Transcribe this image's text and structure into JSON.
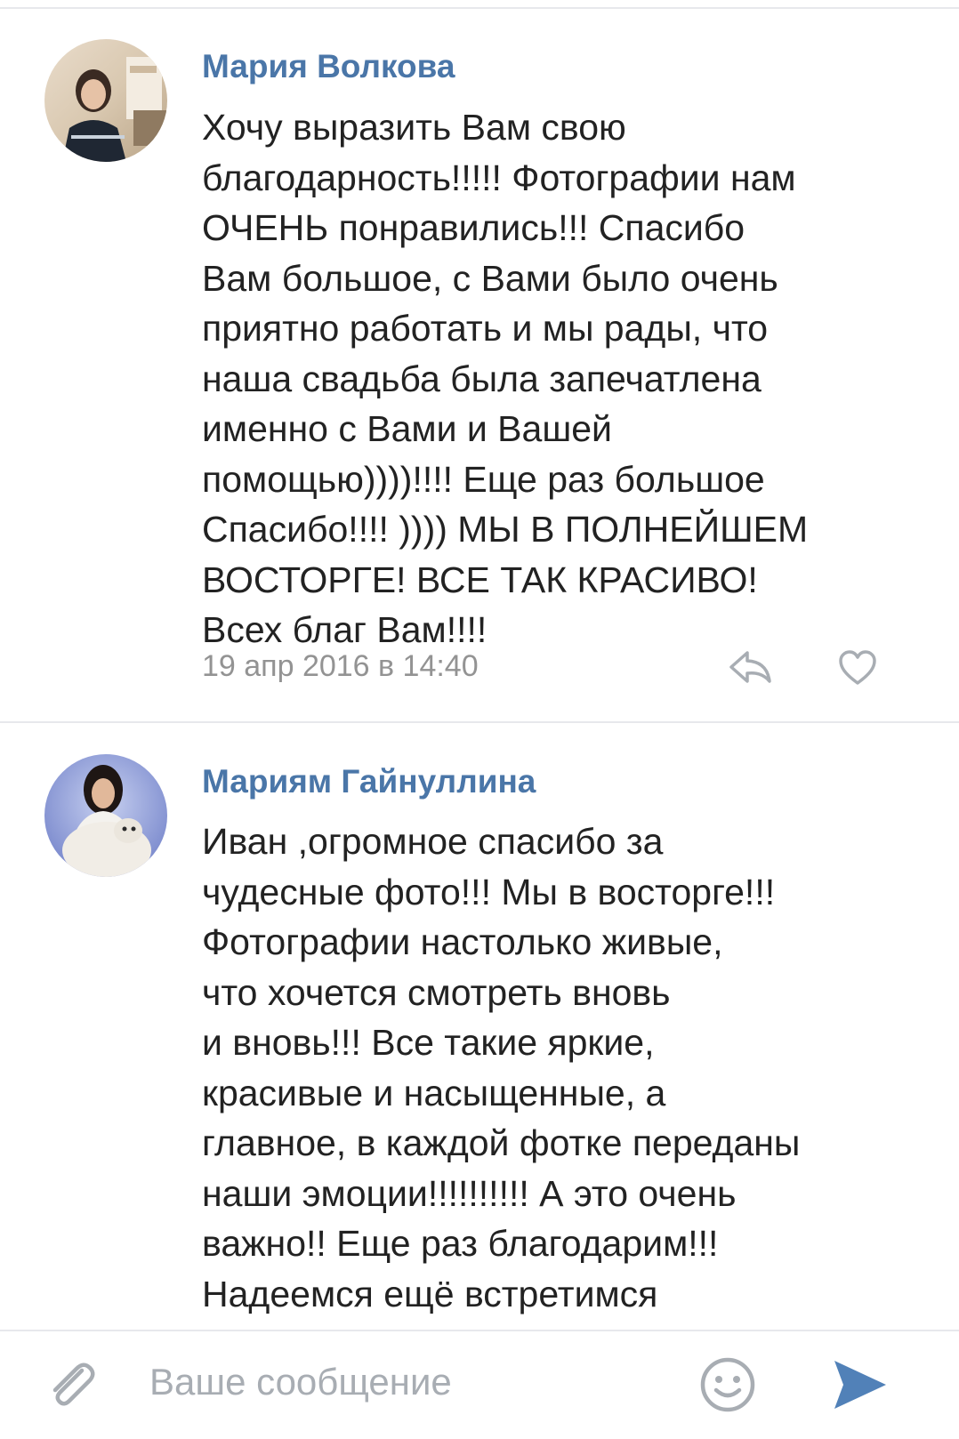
{
  "comments": [
    {
      "author": "Мария Волкова",
      "text": "Хочу выразить Вам свою\nблагодарность!!!!! Фотографии нам\nОЧЕНЬ понравились!!! Спасибо\nВам большое, с Вами было очень\nприятно работать и мы рады, что\nнаша свадьба была запечатлена\nименно с Вами и Вашей\nпомощью))))!!!! Еще раз большое\nСпасибо!!!! )))) МЫ В ПОЛНЕЙШЕМ\nВОСТОРГЕ! ВСЕ ТАК КРАСИВО!\nВсех благ Вам!!!!",
      "date": "19 апр 2016 в 14:40"
    },
    {
      "author": "Мариям Гайнуллина",
      "text": "Иван ,огромное спасибо за\nчудесные фото!!! Мы в восторге!!!\nФотографии настолько живые,\nчто хочется смотреть вновь\nи вновь!!! Все такие яркие,\nкрасивые и насыщенные, а\nглавное, в каждой фотке переданы\nнаши эмоции!!!!!!!!!! А это очень\nважно!! Еще раз благодарим!!!\nНадеемся ещё встретимся"
    }
  ],
  "composer": {
    "placeholder": "Ваше сообщение"
  },
  "icons": {
    "attach": "paperclip-icon",
    "emoji": "smile-icon",
    "send": "send-arrow-icon",
    "reply": "reply-arrow-icon",
    "like": "heart-icon"
  },
  "colors": {
    "author": "#4a76a8",
    "meta": "#939393",
    "send": "#5181b8",
    "icon": "#a8adb3"
  }
}
